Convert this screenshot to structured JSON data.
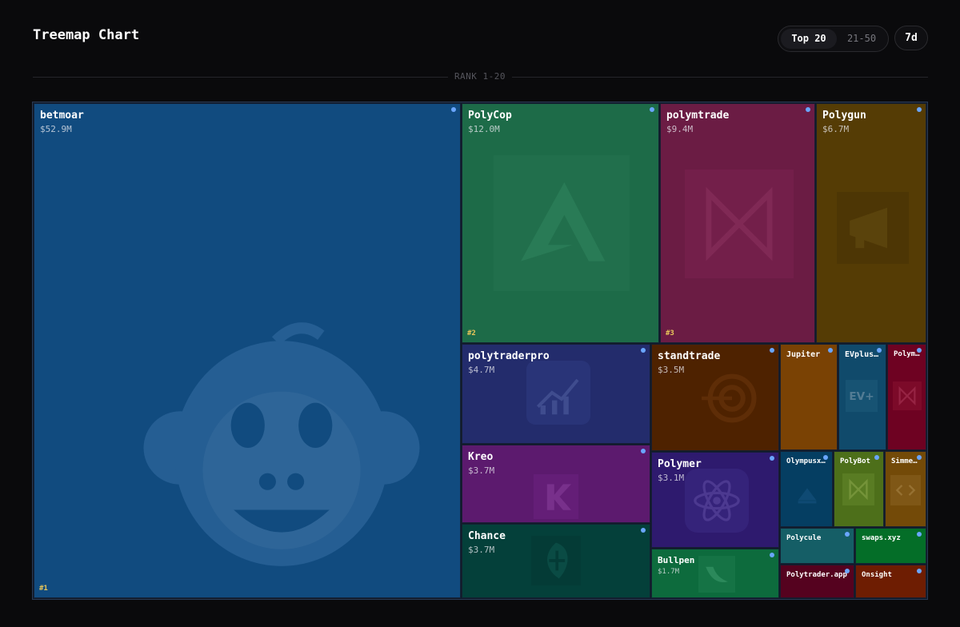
{
  "header": {
    "title": "Treemap Chart",
    "range_active": "Top 20",
    "range_inactive": "21-50",
    "period": "7d"
  },
  "section_label": "RANK 1-20",
  "colors": {
    "background": "#0a0a0c",
    "status_dot": "#6aa6ff",
    "rank_label": "#e8c65a"
  },
  "chart_data": {
    "type": "treemap",
    "unit": "$M",
    "items": [
      {
        "name": "betmoar",
        "value": 52.9,
        "label": "$52.9M",
        "rank": "#1",
        "color": "#114b7f",
        "icon": "monkey-icon"
      },
      {
        "name": "PolyCop",
        "value": 12.0,
        "label": "$12.0M",
        "rank": "#2",
        "color": "#1d6b48",
        "icon": "polycop-logo-icon"
      },
      {
        "name": "polymtrade",
        "value": 9.4,
        "label": "$9.4M",
        "rank": "#3",
        "color": "#6b1c44",
        "icon": "polymtrade-logo-icon"
      },
      {
        "name": "Polygun",
        "value": 6.7,
        "label": "$6.7M",
        "color": "#553c05",
        "icon": "megaphone-icon"
      },
      {
        "name": "polytraderpro",
        "value": 4.7,
        "label": "$4.7M",
        "color": "#232c6c",
        "icon": "chart-up-icon"
      },
      {
        "name": "Kreo",
        "value": 3.7,
        "label": "$3.7M",
        "color": "#5c1a6e",
        "icon": "kreo-logo-icon"
      },
      {
        "name": "Chance",
        "value": 3.7,
        "label": "$3.7M",
        "color": "#04403a",
        "icon": "chance-logo-icon"
      },
      {
        "name": "standtrade",
        "value": 3.5,
        "label": "$3.5M",
        "color": "#4e2200",
        "icon": "target-icon"
      },
      {
        "name": "Polymer",
        "value": 3.1,
        "label": "$3.1M",
        "color": "#2e1a6e",
        "icon": "atom-icon"
      },
      {
        "name": "Bullpen",
        "value": 1.7,
        "label": "$1.7M",
        "color": "#0d6b3d",
        "icon": "bullpen-logo-icon"
      },
      {
        "name": "Jupiter",
        "color": "#7a4204"
      },
      {
        "name": "EVplusAI",
        "color": "#104a6b",
        "icon": "evplus-logo-icon"
      },
      {
        "name": "Polyma…",
        "color": "#6e0222",
        "icon": "polyma-logo-icon"
      },
      {
        "name": "Olympusx…",
        "color": "#053e62",
        "icon": "olympus-logo-icon"
      },
      {
        "name": "PolyBot",
        "color": "#4d6f1a",
        "icon": "polybot-logo-icon"
      },
      {
        "name": "Simmer.M…",
        "color": "#734a08",
        "icon": "code-icon"
      },
      {
        "name": "Polycule",
        "color": "#155e66"
      },
      {
        "name": "swaps.xyz",
        "color": "#046e28"
      },
      {
        "name": "Polytrader.app",
        "color": "#55021f"
      },
      {
        "name": "Onsight",
        "color": "#6e1d02"
      }
    ]
  }
}
